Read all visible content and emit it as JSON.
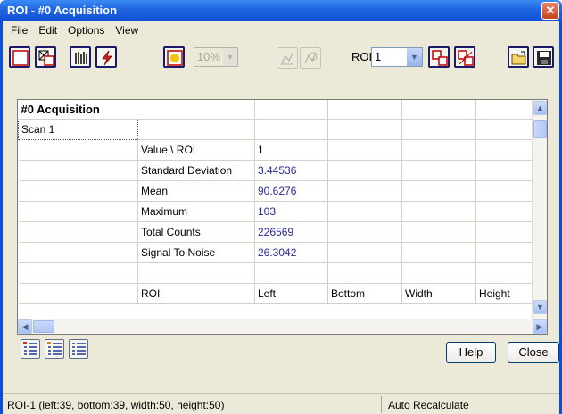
{
  "window": {
    "title": "ROI - #0  Acquisition",
    "close_glyph": "✕"
  },
  "menu": [
    "File",
    "Edit",
    "Options",
    "View"
  ],
  "toolbar": {
    "zoom_value": "10%",
    "roi_label": "ROI",
    "roi_selected": "1",
    "icons": [
      "draw-roi-icon",
      "delete-roi-icon",
      "column-icon",
      "lightning-icon",
      "overlay-icon",
      "histogram-icon",
      "profile-icon",
      "link-roi-icon",
      "unlink-roi-icon",
      "open-folder-icon",
      "save-icon"
    ]
  },
  "grid": {
    "header": "#0  Acquisition",
    "scan_label": "Scan 1",
    "stats_header": {
      "label": "Value  \\  ROI",
      "value": "1"
    },
    "stats": [
      {
        "label": "Standard Deviation",
        "value": "3.44536"
      },
      {
        "label": "Mean",
        "value": "90.6276"
      },
      {
        "label": "Maximum",
        "value": "103"
      },
      {
        "label": "Total Counts",
        "value": "226569"
      },
      {
        "label": "Signal To Noise",
        "value": "26.3042"
      }
    ],
    "roi_header": [
      "ROI",
      "Left",
      "Bottom",
      "Width",
      "Height"
    ]
  },
  "buttons": {
    "help": "Help",
    "close": "Close"
  },
  "status": {
    "left": "ROI-1   (left:39, bottom:39, width:50, height:50)",
    "right": "Auto Recalculate"
  },
  "colors": {
    "title_bar": "#1f64e0",
    "value_text": "#2a2a9a",
    "face": "#ece9d8"
  }
}
